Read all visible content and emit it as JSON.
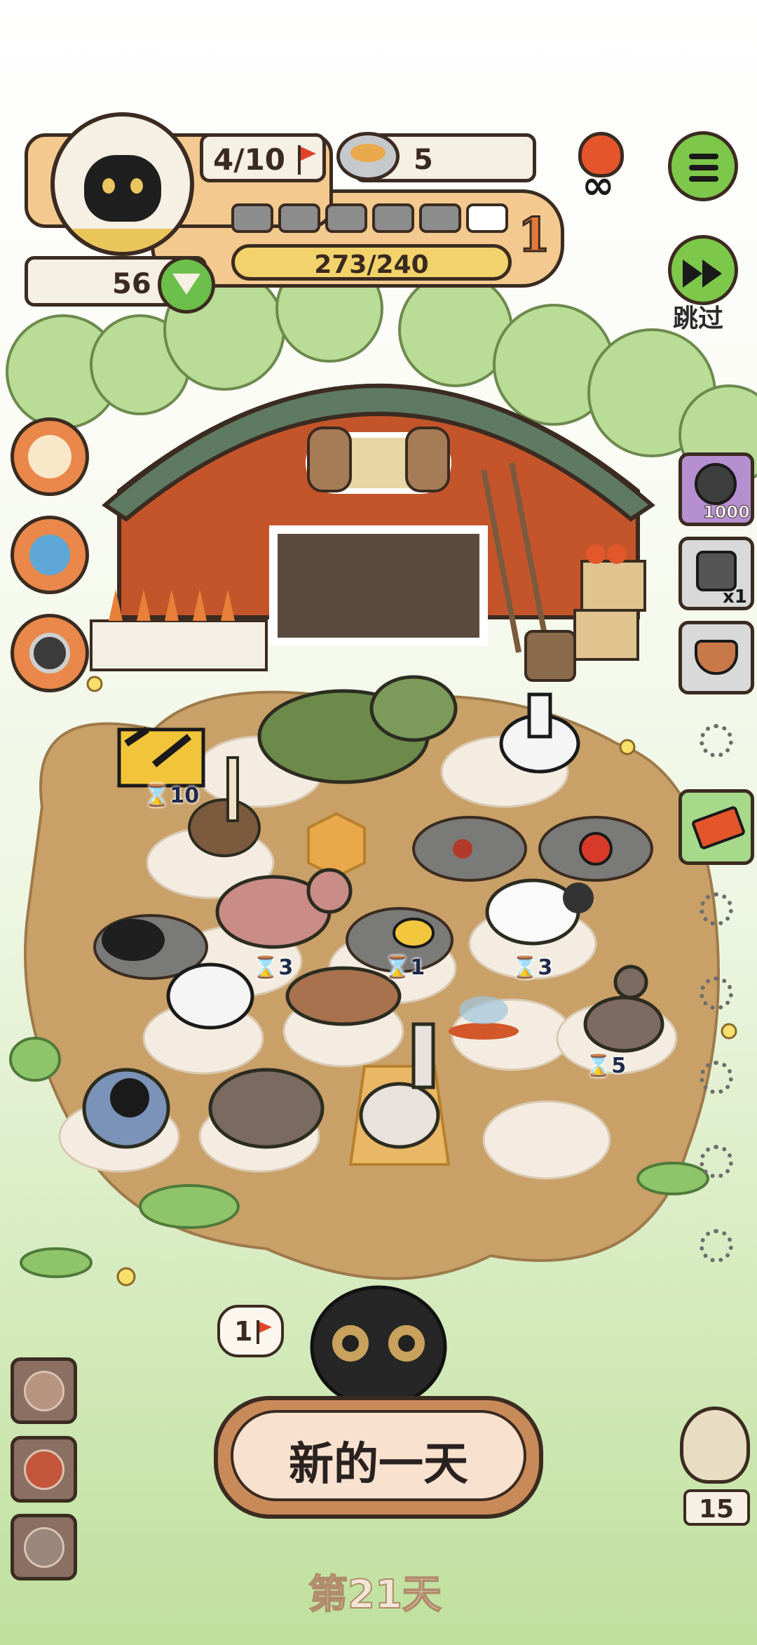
{
  "hud": {
    "pop_current_max": "4/10",
    "food": "5",
    "energy": "56",
    "exp": "273/240",
    "level": "1",
    "exp_segments_filled": 5,
    "exp_segments_total": 6
  },
  "controls": {
    "skip_label": "跳过",
    "infinite_symbol": "∞"
  },
  "side_items": {
    "film_count": "1000",
    "gadget_count": "x1"
  },
  "timers": {
    "barrier": "10",
    "zebra": "3",
    "bee": "1",
    "sheep": "3",
    "donkey": "5"
  },
  "bottom": {
    "new_day_label": "新的一天",
    "day_label": "第21天",
    "flag_bubble": "1",
    "owl_count": "15"
  },
  "colors": {
    "green_button": "#7dc74a",
    "hud_orange": "#f3c98f",
    "barn_red": "#c4552b",
    "dirt": "#c9a068",
    "grass": "#cfe6b5"
  }
}
